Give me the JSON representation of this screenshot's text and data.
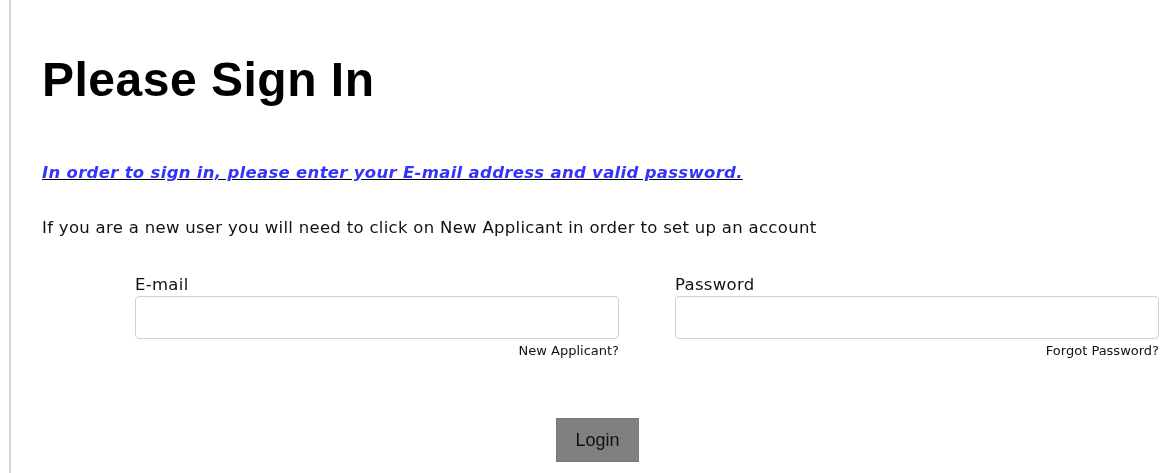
{
  "title": "Please Sign In",
  "instruction_link": "In order to sign in, please enter your E-mail address and valid password.",
  "note": "If you are a new user you will need to click on New Applicant in order to set up an account",
  "fields": [
    {
      "label": "E-mail",
      "link": "New Applicant?"
    },
    {
      "label": "Password",
      "link": "Forgot Password?"
    }
  ],
  "button": "Login"
}
